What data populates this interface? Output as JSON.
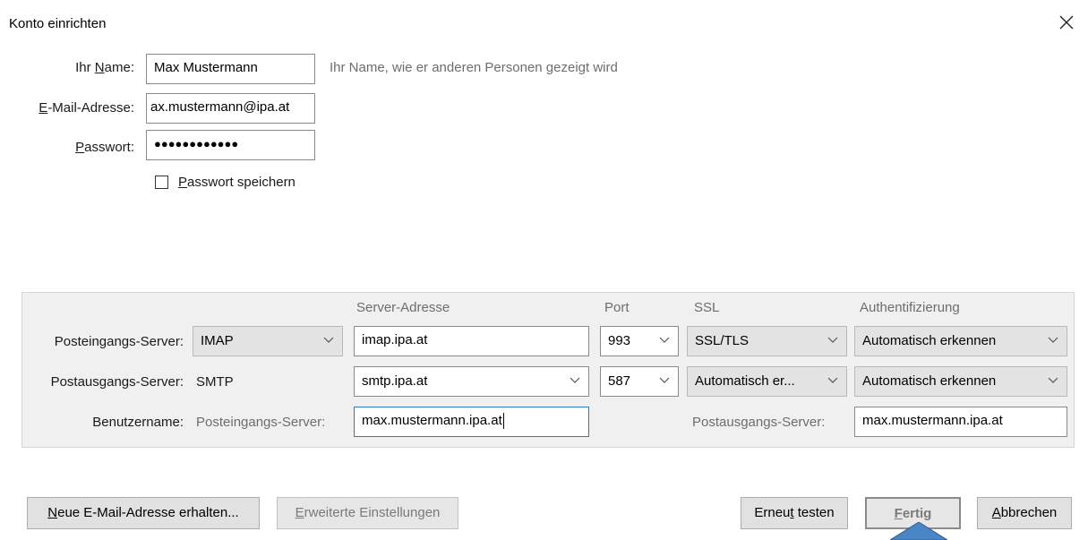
{
  "window": {
    "title": "Konto einrichten",
    "close_icon": "close-icon"
  },
  "form": {
    "name": {
      "label_pre": "Ihr ",
      "label_u": "N",
      "label_post": "ame:",
      "value": "Max Mustermann",
      "hint": "Ihr Name, wie er anderen Personen gezeigt wird"
    },
    "email": {
      "label_u": "E",
      "label_post": "-Mail-Adresse:",
      "value": "ax.mustermann@ipa.at"
    },
    "password": {
      "label_u": "P",
      "label_post": "asswort:",
      "value": "●●●●●●●●●●●●"
    },
    "save_password": {
      "label_u": "P",
      "label_post": "asswort speichern",
      "checked": false
    }
  },
  "servers": {
    "headers": {
      "address": "Server-Adresse",
      "port": "Port",
      "ssl": "SSL",
      "auth": "Authentifizierung"
    },
    "incoming": {
      "label": "Posteingangs-Server:",
      "protocol": "IMAP",
      "address": "imap.ipa.at",
      "port": "993",
      "ssl": "SSL/TLS",
      "auth": "Automatisch erkennen"
    },
    "outgoing": {
      "label": "Postausgangs-Server:",
      "protocol": "SMTP",
      "address": "smtp.ipa.at",
      "port": "587",
      "ssl": "Automatisch er...",
      "auth": "Automatisch erkennen"
    },
    "username": {
      "label": "Benutzername:",
      "incoming_label": "Posteingangs-Server:",
      "incoming_value": "max.mustermann.ipa.at",
      "outgoing_label": "Postausgangs-Server:",
      "outgoing_value": "max.mustermann.ipa.at"
    }
  },
  "buttons": {
    "new_email": {
      "u": "N",
      "rest": "eue E-Mail-Adresse erhalten..."
    },
    "advanced": {
      "u": "E",
      "rest": "rweiterte Einstellungen"
    },
    "retest": {
      "pre": "Erneu",
      "u": "t",
      "rest": " testen"
    },
    "done": {
      "u": "F",
      "rest": "ertig"
    },
    "cancel": {
      "u": "A",
      "rest": "bbrechen"
    }
  },
  "colors": {
    "cursor": "#4a86c6",
    "panel": "#f0f0f0",
    "focus": "#2b78d0"
  }
}
